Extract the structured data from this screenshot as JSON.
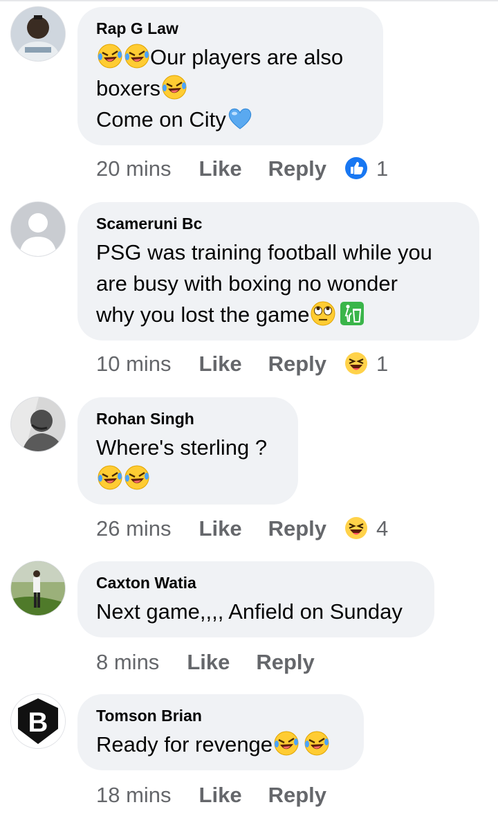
{
  "comments": [
    {
      "author": "Rap G Law",
      "lines": [
        "Our players are also",
        "boxers",
        "Come on City"
      ],
      "time": "20 mins",
      "like_label": "Like",
      "reply_label": "Reply",
      "reaction_icon": "like-reaction-icon",
      "reaction_count": "1"
    },
    {
      "author": "Scameruni Bc",
      "lines": [
        "PSG was training football while you",
        "are busy with boxing no wonder",
        "why you lost the game"
      ],
      "time": "10 mins",
      "like_label": "Like",
      "reply_label": "Reply",
      "reaction_icon": "haha-reaction-icon",
      "reaction_count": "1"
    },
    {
      "author": "Rohan Singh",
      "lines": [
        "Where's sterling ?"
      ],
      "time": "26 mins",
      "like_label": "Like",
      "reply_label": "Reply",
      "reaction_icon": "haha-reaction-icon",
      "reaction_count": "4"
    },
    {
      "author": "Caxton Watia",
      "lines": [
        "Next game,,,, Anfield on Sunday"
      ],
      "time": "8 mins",
      "like_label": "Like",
      "reply_label": "Reply"
    },
    {
      "author": "Tomson Brian",
      "lines": [
        "Ready for revenge"
      ],
      "time": "18 mins",
      "like_label": "Like",
      "reply_label": "Reply",
      "avatar_letter": "B"
    }
  ],
  "colors": {
    "bubble": "#f0f2f5",
    "meta_text": "#65676b",
    "like_blue": "#1877f2",
    "heart_blue": "#5aa9f0"
  }
}
